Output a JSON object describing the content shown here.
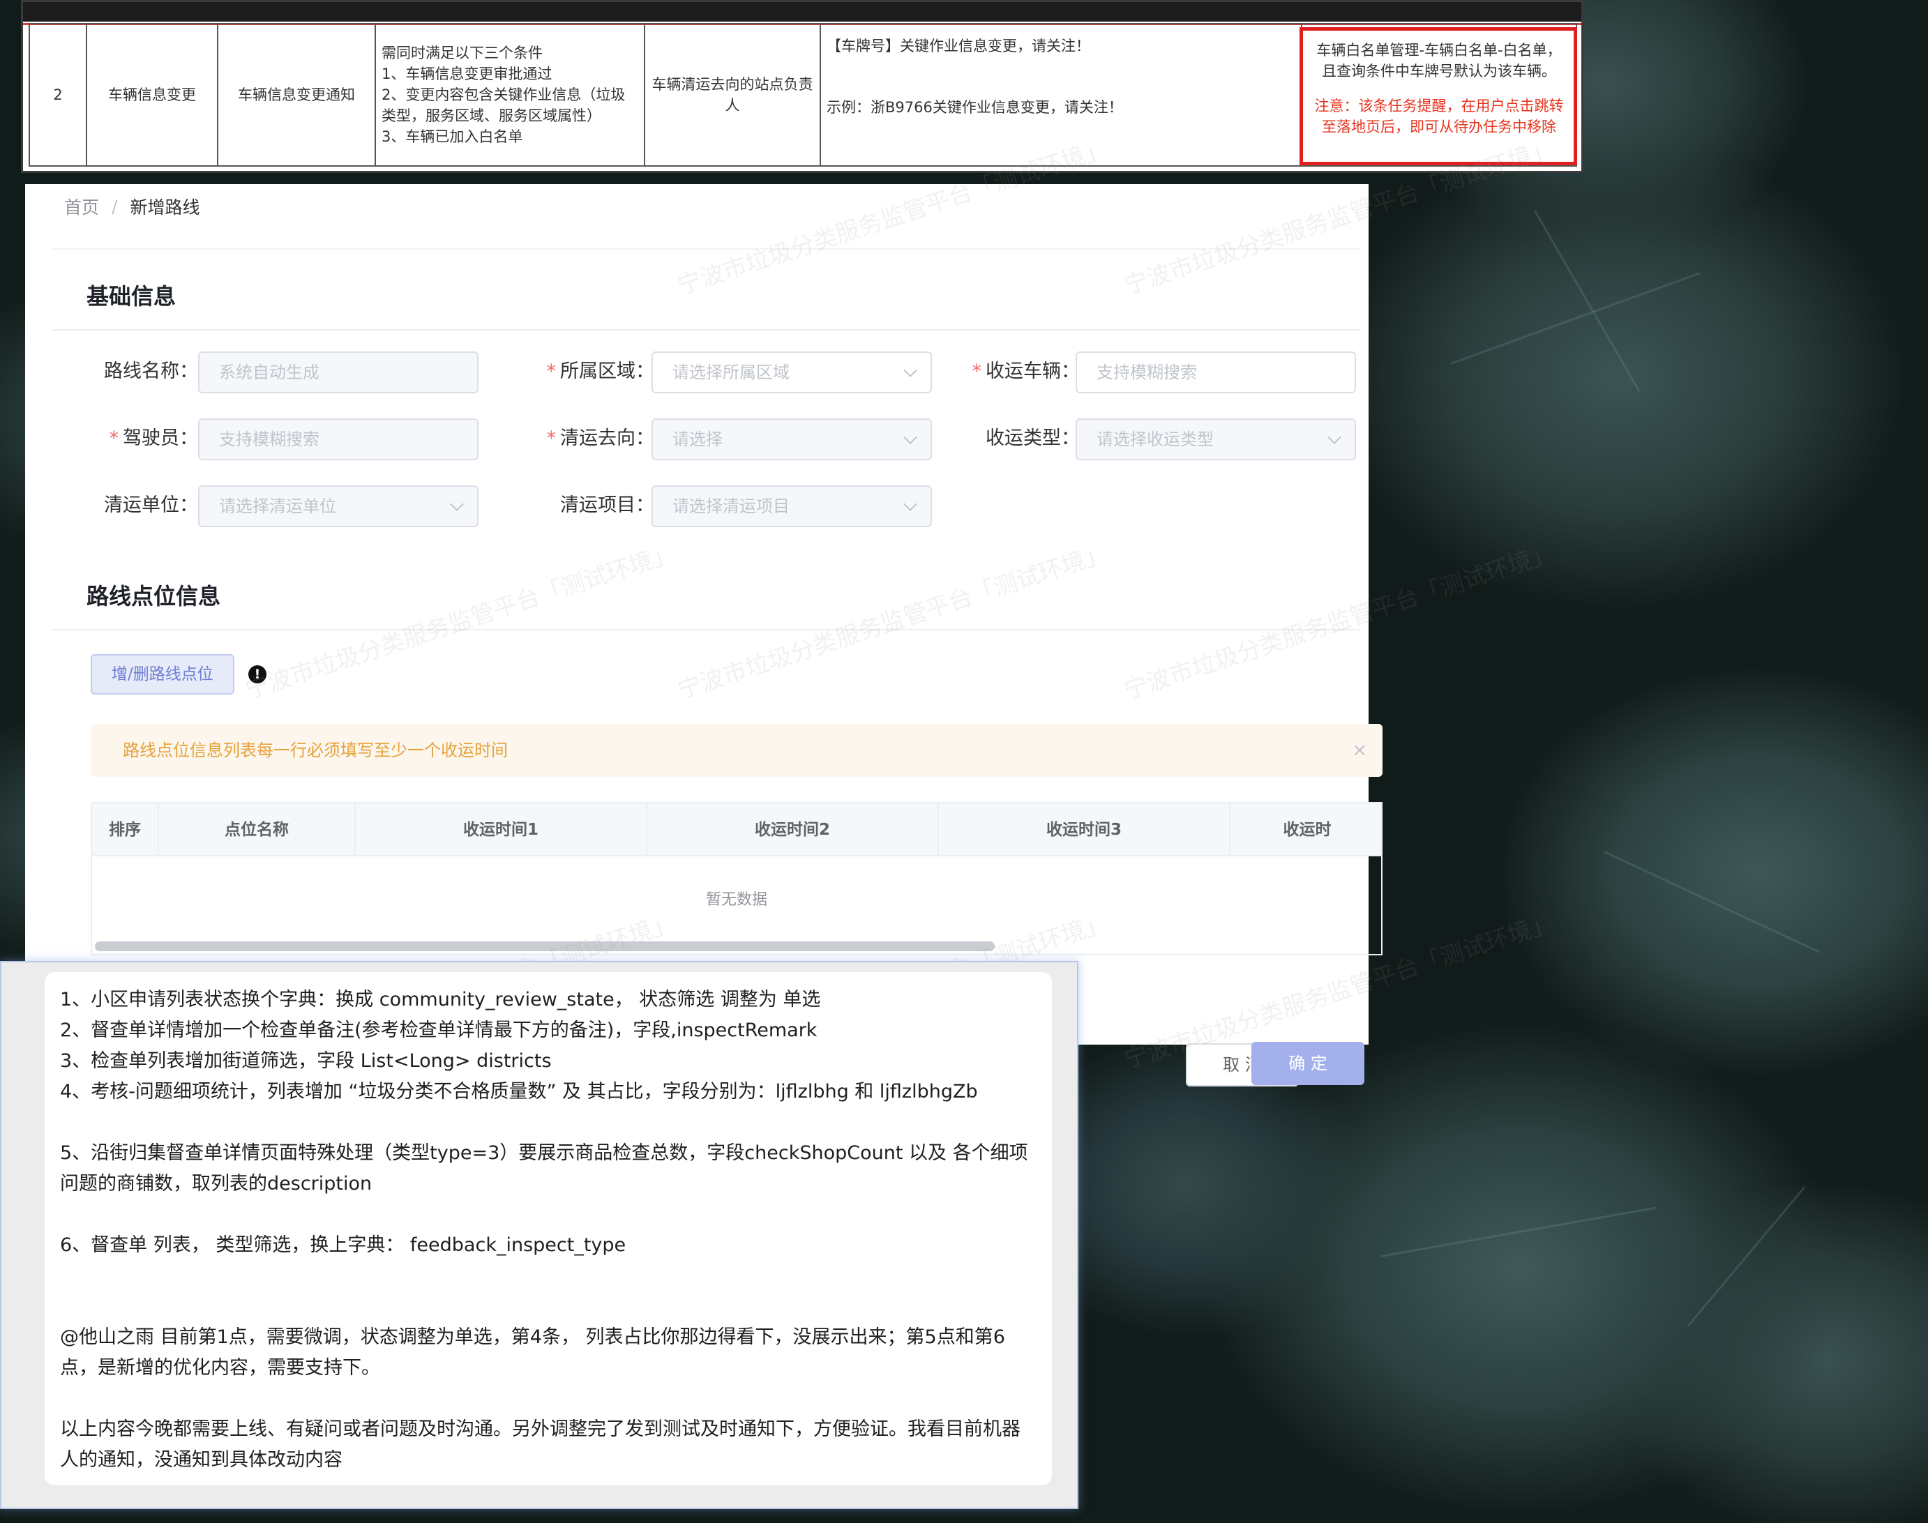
{
  "table_row": {
    "index": "2",
    "category": "车辆信息变更",
    "name": "车辆信息变更通知",
    "conditions": [
      "需同时满足以下三个条件",
      "1、车辆信息变更审批通过",
      "2、变更内容包含关键作业信息（垃圾",
      "类型，服务区域、服务区域属性）",
      "3、车辆已加入白名单"
    ],
    "recipient": "车辆清运去向的站点负责人",
    "message_line1": "【车牌号】关键作业信息变更，请关注！",
    "message_line2": "示例：浙B9766关键作业信息变更，请关注！",
    "note_black": "车辆白名单管理-车辆白名单-白名单，且查询条件中车牌号默认为该车辆。",
    "note_red": "注意：该条任务提醒，在用户点击跳转至落地页后，即可从待办任务中移除"
  },
  "breadcrumb": {
    "home": "首页",
    "separator": "/",
    "current": "新增路线"
  },
  "basic_section": {
    "title": "基础信息"
  },
  "fields": {
    "route_name": {
      "label": "路线名称：",
      "placeholder": "系统自动生成"
    },
    "region": {
      "label": "所属区域：",
      "placeholder": "请选择所属区域"
    },
    "vehicle": {
      "label": "收运车辆：",
      "placeholder": "支持模糊搜索"
    },
    "driver": {
      "label": "驾驶员：",
      "placeholder": "支持模糊搜索"
    },
    "destination": {
      "label": "清运去向：",
      "placeholder": "请选择"
    },
    "collect_type": {
      "label": "收运类型：",
      "placeholder": "请选择收运类型"
    },
    "company": {
      "label": "清运单位：",
      "placeholder": "请选择清运单位"
    },
    "project": {
      "label": "清运项目：",
      "placeholder": "请选择清运项目"
    }
  },
  "required_mark": "*",
  "route_section": {
    "title": "路线点位信息"
  },
  "route_button": "增/删路线点位",
  "info_icon": "exclamation-circle-icon",
  "alert_text": "路线点位信息列表每一行必须填写至少一个收运时间",
  "alert_close": "×",
  "table_headers": [
    "排序",
    "点位名称",
    "收运时间1",
    "收运时间2",
    "收运时间3",
    "收运时"
  ],
  "empty_text": "暂无数据",
  "buttons": {
    "cancel": "取 消",
    "ok": "确 定"
  },
  "watermark_text": "宁波市垃圾分类服务监管平台「测试环境」",
  "message": {
    "lines": [
      "1、小区申请列表状态换个字典：换成 community_review_state， 状态筛选 调整为 单选",
      "2、督查单详情增加一个检查单备注(参考检查单详情最下方的备注)，字段,inspectRemark",
      "3、检查单列表增加街道筛选，字段  List<Long> districts",
      "4、考核-问题细项统计，列表增加 “垃圾分类不合格质量数” 及 其占比，字段分别为：ljflzlbhg  和 ljflzlbhgZb",
      "5、沿街归集督查单详情页面特殊处理（类型type=3）要展示商品检查总数，字段checkShopCount 以及 各个细项问题的商铺数，取列表的description",
      "6、督查单 列表， 类型筛选，换上字典：  feedback_inspect_type",
      "@他山之雨    目前第1点，需要微调，状态调整为单选，第4条， 列表占比你那边得看下，没展示出来；第5点和第6点，是新增的优化内容，需要支持下。",
      "以上内容今晚都需要上线、有疑问或者问题及时沟通。另外调整完了发到测试及时通知下，方便验证。我看目前机器人的通知，没通知到具体改动内容"
    ]
  },
  "colors": {
    "accent": "#a4b0ec",
    "required": "#f56c6c",
    "alert_text": "#e6a23c",
    "alert_bg": "#fdf6ec",
    "note_red": "#e8341f"
  }
}
